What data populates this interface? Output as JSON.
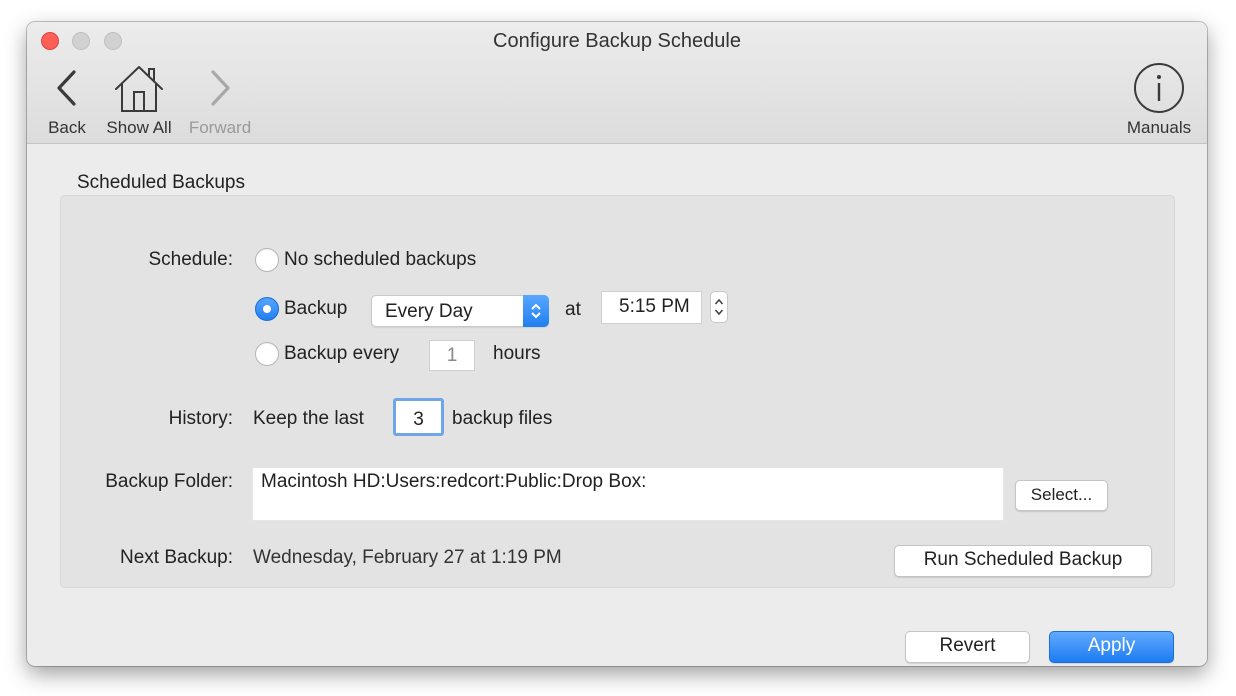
{
  "window": {
    "title": "Configure Backup Schedule"
  },
  "toolbar": {
    "back_label": "Back",
    "show_all_label": "Show All",
    "forward_label": "Forward",
    "manuals_label": "Manuals"
  },
  "group": {
    "title": "Scheduled Backups"
  },
  "schedule": {
    "label": "Schedule:",
    "option_none": "No scheduled backups",
    "option_backup": "Backup",
    "frequency_selected": "Every Day",
    "at_label": "at",
    "time_value": "5:15 PM",
    "option_every": "Backup every",
    "hours_value": "1",
    "hours_label": "hours",
    "selected_option": "Backup"
  },
  "history": {
    "label": "History:",
    "prefix": "Keep the last",
    "count_value": "3",
    "suffix": "backup files"
  },
  "folder": {
    "label": "Backup Folder:",
    "path": "Macintosh HD:Users:redcort:Public:Drop Box:",
    "select_button": "Select..."
  },
  "next_backup": {
    "label": "Next Backup:",
    "value": "Wednesday, February 27 at 1:19 PM",
    "run_button": "Run Scheduled Backup"
  },
  "footer": {
    "revert_button": "Revert",
    "apply_button": "Apply"
  },
  "colors": {
    "accent": "#1f7ff0",
    "close_button": "#fe5f57",
    "focus_ring": "#6ea6e8"
  },
  "icons": {
    "back": "chevron-left-icon",
    "show_all": "house-icon",
    "forward": "chevron-right-icon",
    "manuals": "info-icon"
  }
}
